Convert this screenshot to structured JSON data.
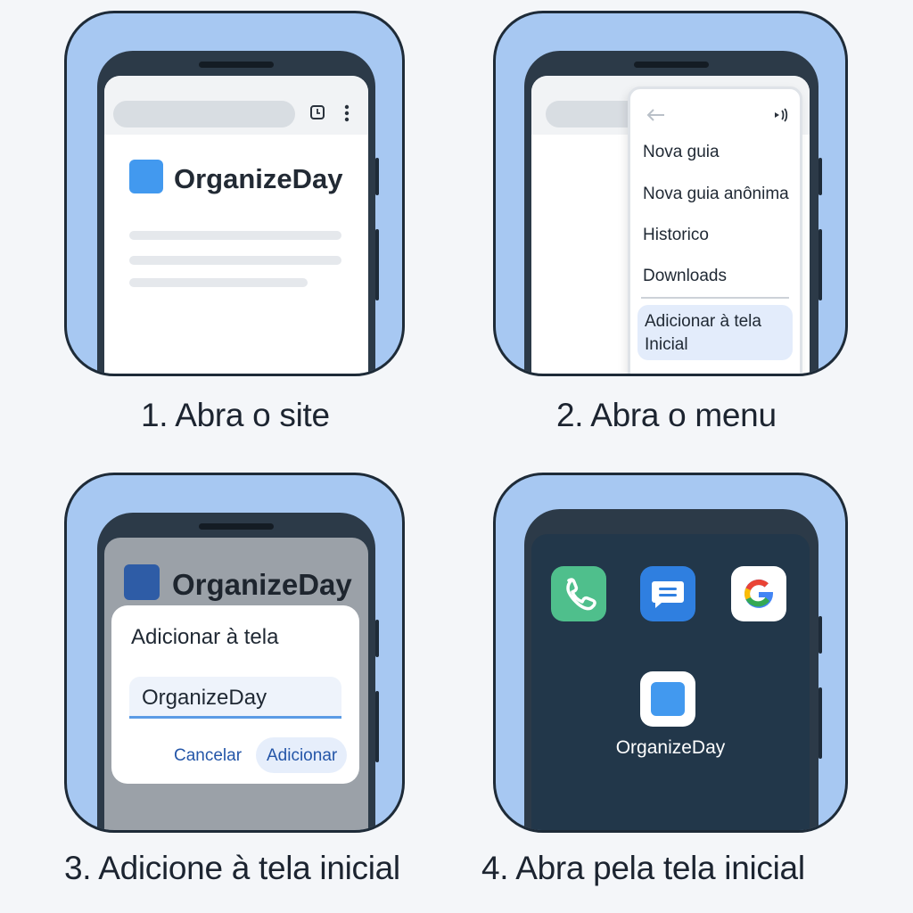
{
  "steps": [
    {
      "caption": "1. Abra o site"
    },
    {
      "caption": "2. Abra o menu"
    },
    {
      "caption": "3. Adicione à tela inicial"
    },
    {
      "caption": "4. Abra pela tela inicial"
    }
  ],
  "site": {
    "name": "OrganizeDay"
  },
  "browser_menu": {
    "items": [
      "Nova guia",
      "Nova guia anônima",
      "Historico",
      "Downloads"
    ],
    "highlighted": [
      "Adicionar à tela",
      "Inicial"
    ]
  },
  "add_dialog": {
    "title": "Adicionar à tela",
    "field_value": "OrganizeDay",
    "cancel_label": "Cancelar",
    "add_label": "Adicionar"
  },
  "home_screen": {
    "apps": [
      "phone-app",
      "messages-app",
      "google-app"
    ],
    "shortcut_label": "OrganizeDay"
  },
  "colors": {
    "frame": "#a7c8f2",
    "brand_blue": "#4299ef",
    "home_bg": "#22374a"
  }
}
